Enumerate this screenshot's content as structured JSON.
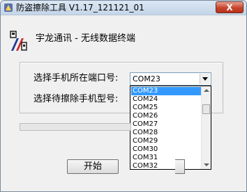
{
  "window": {
    "title": "防盗擦除工具 V1.17_121121_01",
    "close_label": "X"
  },
  "brand": {
    "text": "宇龙通讯 - 无线数据终端"
  },
  "form": {
    "port_label": "选择手机所在端口号:",
    "model_label": "选择待擦除手机型号:",
    "port_selected": "COM23"
  },
  "port_options": [
    "COM23",
    "COM24",
    "COM25",
    "COM26",
    "COM27",
    "COM28",
    "COM29",
    "COM30",
    "COM31",
    "COM32"
  ],
  "buttons": {
    "start": "开始"
  },
  "colors": {
    "selection": "#3399ff",
    "close_button": "#c7452c"
  }
}
